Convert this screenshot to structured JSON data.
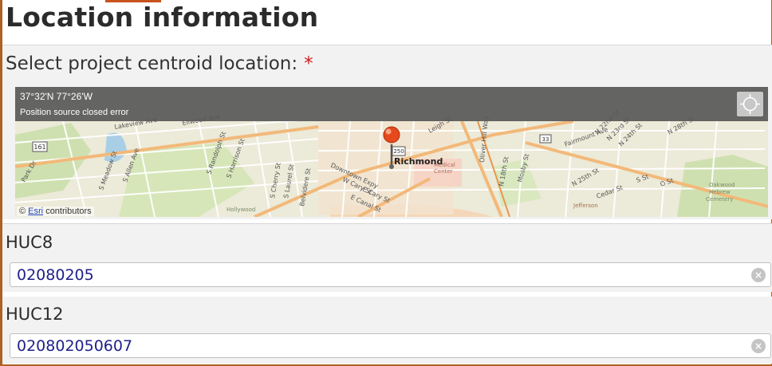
{
  "header": {
    "title": "Location information"
  },
  "location": {
    "select_label": "Select project centroid location:",
    "required_mark": "*"
  },
  "map": {
    "coords": "37°32'N 77°26'W",
    "position_error": "Position source closed error",
    "attribution_prefix": "©",
    "attribution_link": "Esri",
    "attribution_suffix": "contributors",
    "marker_label": "Richmond",
    "street_labels": [
      "Lakeview Ave",
      "Ellwood Ave",
      "S Randolph St",
      "S Harrison St",
      "S Meadow St",
      "S Allen Ave",
      "S Cherry St",
      "S Laurel St",
      "Belvidere St",
      "Park Dr",
      "W Cary St",
      "E Cary St",
      "E Canal St",
      "Downtown Expy",
      "Oliver Hill Way",
      "N 18th St",
      "Mosby St",
      "Fairmount Ave",
      "N 22nd St",
      "N 23rd St",
      "N 24th St",
      "N 25th St",
      "N 28th St",
      "S St",
      "O St",
      "Cedar St",
      "Leigh St",
      "Oakwood Hebrew Cemetery",
      "Hollywood",
      "Jefferson",
      "Medical Center"
    ],
    "road_shields": [
      "161",
      "250",
      "33"
    ]
  },
  "huc8": {
    "label": "HUC8",
    "value": "02080205"
  },
  "huc12": {
    "label": "HUC12",
    "value": "020802050607"
  },
  "icons": {
    "locate": "crosshair-icon",
    "clear": "clear-circle-icon",
    "marker": "map-pin-icon"
  },
  "colors": {
    "accent": "#c8521b",
    "value_text": "#20208a",
    "required": "#d01c1c"
  }
}
